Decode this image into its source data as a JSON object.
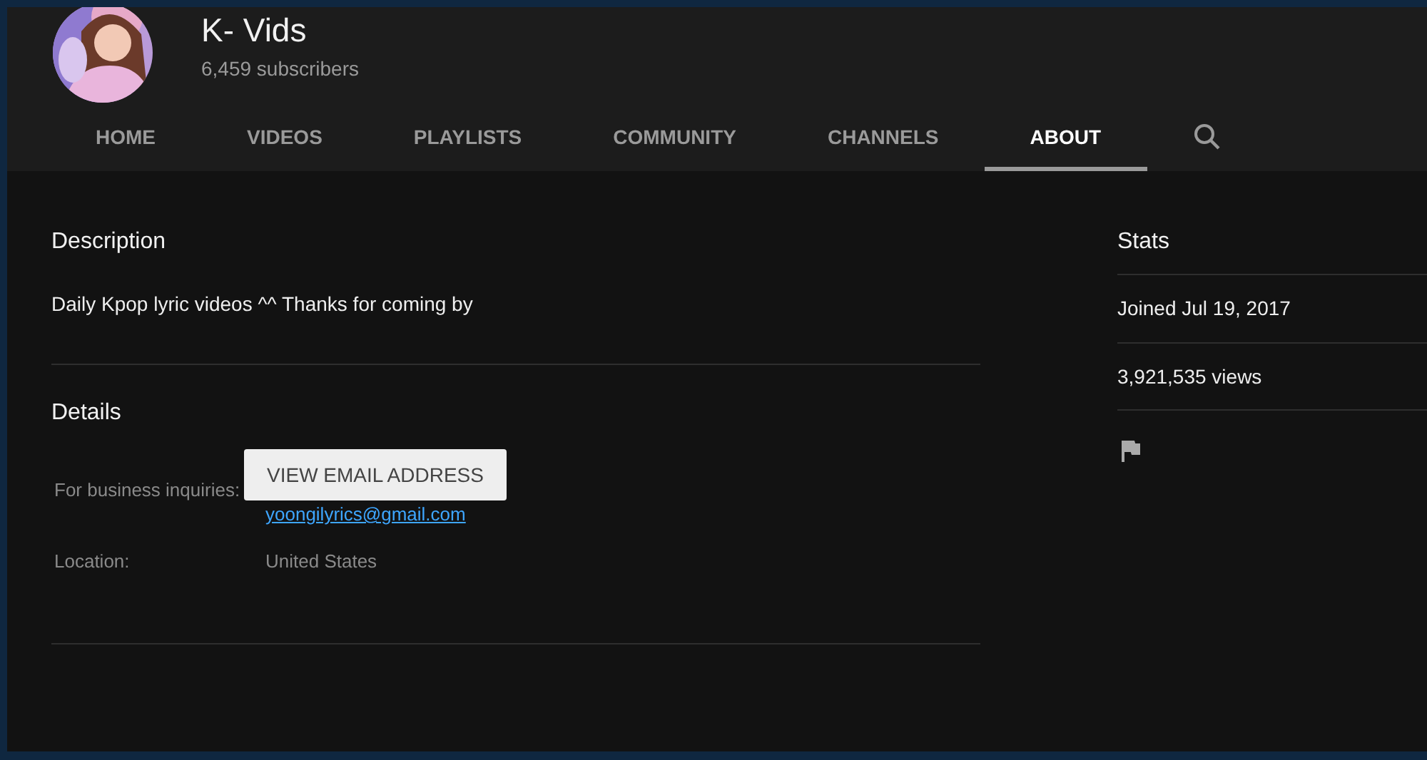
{
  "channel": {
    "name": "K- Vids",
    "subscribers": "6,459 subscribers"
  },
  "tabs": [
    {
      "label": "HOME",
      "selected": false
    },
    {
      "label": "VIDEOS",
      "selected": false
    },
    {
      "label": "PLAYLISTS",
      "selected": false
    },
    {
      "label": "COMMUNITY",
      "selected": false
    },
    {
      "label": "CHANNELS",
      "selected": false
    },
    {
      "label": "ABOUT",
      "selected": true
    }
  ],
  "description": {
    "heading": "Description",
    "text": "Daily Kpop lyric videos ^^ Thanks for coming by"
  },
  "details": {
    "heading": "Details",
    "business_label": "For business inquiries:",
    "email_button": "VIEW EMAIL ADDRESS",
    "email": "yoongilyrics@gmail.com",
    "location_label": "Location:",
    "location": "United States"
  },
  "stats": {
    "heading": "Stats",
    "joined": "Joined Jul 19, 2017",
    "views": "3,921,535 views"
  }
}
